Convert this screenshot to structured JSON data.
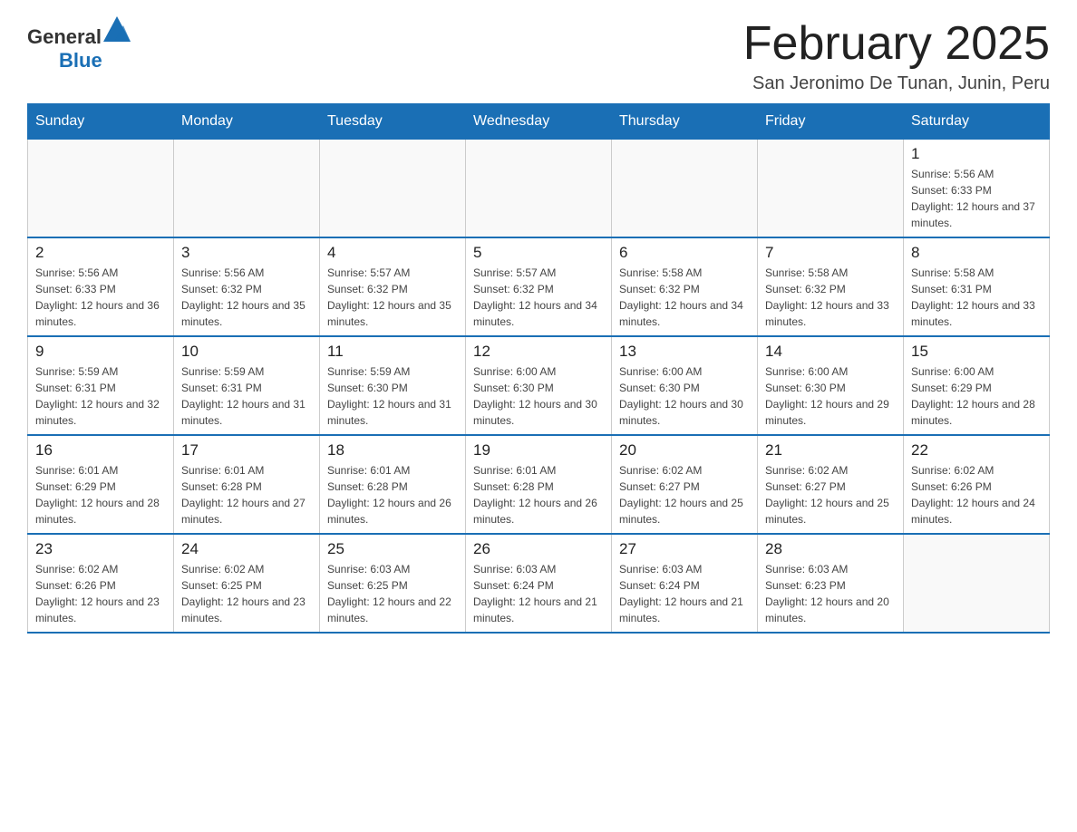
{
  "header": {
    "logo_general": "General",
    "logo_blue": "Blue",
    "title": "February 2025",
    "subtitle": "San Jeronimo De Tunan, Junin, Peru"
  },
  "days_of_week": [
    "Sunday",
    "Monday",
    "Tuesday",
    "Wednesday",
    "Thursday",
    "Friday",
    "Saturday"
  ],
  "weeks": [
    [
      {
        "day": "",
        "info": ""
      },
      {
        "day": "",
        "info": ""
      },
      {
        "day": "",
        "info": ""
      },
      {
        "day": "",
        "info": ""
      },
      {
        "day": "",
        "info": ""
      },
      {
        "day": "",
        "info": ""
      },
      {
        "day": "1",
        "info": "Sunrise: 5:56 AM\nSunset: 6:33 PM\nDaylight: 12 hours and 37 minutes."
      }
    ],
    [
      {
        "day": "2",
        "info": "Sunrise: 5:56 AM\nSunset: 6:33 PM\nDaylight: 12 hours and 36 minutes."
      },
      {
        "day": "3",
        "info": "Sunrise: 5:56 AM\nSunset: 6:32 PM\nDaylight: 12 hours and 35 minutes."
      },
      {
        "day": "4",
        "info": "Sunrise: 5:57 AM\nSunset: 6:32 PM\nDaylight: 12 hours and 35 minutes."
      },
      {
        "day": "5",
        "info": "Sunrise: 5:57 AM\nSunset: 6:32 PM\nDaylight: 12 hours and 34 minutes."
      },
      {
        "day": "6",
        "info": "Sunrise: 5:58 AM\nSunset: 6:32 PM\nDaylight: 12 hours and 34 minutes."
      },
      {
        "day": "7",
        "info": "Sunrise: 5:58 AM\nSunset: 6:32 PM\nDaylight: 12 hours and 33 minutes."
      },
      {
        "day": "8",
        "info": "Sunrise: 5:58 AM\nSunset: 6:31 PM\nDaylight: 12 hours and 33 minutes."
      }
    ],
    [
      {
        "day": "9",
        "info": "Sunrise: 5:59 AM\nSunset: 6:31 PM\nDaylight: 12 hours and 32 minutes."
      },
      {
        "day": "10",
        "info": "Sunrise: 5:59 AM\nSunset: 6:31 PM\nDaylight: 12 hours and 31 minutes."
      },
      {
        "day": "11",
        "info": "Sunrise: 5:59 AM\nSunset: 6:30 PM\nDaylight: 12 hours and 31 minutes."
      },
      {
        "day": "12",
        "info": "Sunrise: 6:00 AM\nSunset: 6:30 PM\nDaylight: 12 hours and 30 minutes."
      },
      {
        "day": "13",
        "info": "Sunrise: 6:00 AM\nSunset: 6:30 PM\nDaylight: 12 hours and 30 minutes."
      },
      {
        "day": "14",
        "info": "Sunrise: 6:00 AM\nSunset: 6:30 PM\nDaylight: 12 hours and 29 minutes."
      },
      {
        "day": "15",
        "info": "Sunrise: 6:00 AM\nSunset: 6:29 PM\nDaylight: 12 hours and 28 minutes."
      }
    ],
    [
      {
        "day": "16",
        "info": "Sunrise: 6:01 AM\nSunset: 6:29 PM\nDaylight: 12 hours and 28 minutes."
      },
      {
        "day": "17",
        "info": "Sunrise: 6:01 AM\nSunset: 6:28 PM\nDaylight: 12 hours and 27 minutes."
      },
      {
        "day": "18",
        "info": "Sunrise: 6:01 AM\nSunset: 6:28 PM\nDaylight: 12 hours and 26 minutes."
      },
      {
        "day": "19",
        "info": "Sunrise: 6:01 AM\nSunset: 6:28 PM\nDaylight: 12 hours and 26 minutes."
      },
      {
        "day": "20",
        "info": "Sunrise: 6:02 AM\nSunset: 6:27 PM\nDaylight: 12 hours and 25 minutes."
      },
      {
        "day": "21",
        "info": "Sunrise: 6:02 AM\nSunset: 6:27 PM\nDaylight: 12 hours and 25 minutes."
      },
      {
        "day": "22",
        "info": "Sunrise: 6:02 AM\nSunset: 6:26 PM\nDaylight: 12 hours and 24 minutes."
      }
    ],
    [
      {
        "day": "23",
        "info": "Sunrise: 6:02 AM\nSunset: 6:26 PM\nDaylight: 12 hours and 23 minutes."
      },
      {
        "day": "24",
        "info": "Sunrise: 6:02 AM\nSunset: 6:25 PM\nDaylight: 12 hours and 23 minutes."
      },
      {
        "day": "25",
        "info": "Sunrise: 6:03 AM\nSunset: 6:25 PM\nDaylight: 12 hours and 22 minutes."
      },
      {
        "day": "26",
        "info": "Sunrise: 6:03 AM\nSunset: 6:24 PM\nDaylight: 12 hours and 21 minutes."
      },
      {
        "day": "27",
        "info": "Sunrise: 6:03 AM\nSunset: 6:24 PM\nDaylight: 12 hours and 21 minutes."
      },
      {
        "day": "28",
        "info": "Sunrise: 6:03 AM\nSunset: 6:23 PM\nDaylight: 12 hours and 20 minutes."
      },
      {
        "day": "",
        "info": ""
      }
    ]
  ]
}
